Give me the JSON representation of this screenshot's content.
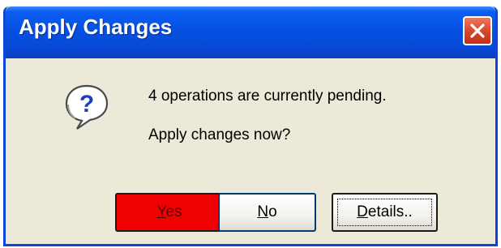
{
  "window": {
    "title": "Apply Changes",
    "close_icon": "close-icon"
  },
  "message": {
    "icon": "question-icon",
    "line1": "4 operations are currently pending.",
    "line2": "Apply changes now?"
  },
  "buttons": {
    "yes": {
      "label": "Yes",
      "mnemonic": "Y",
      "rest": "es"
    },
    "no": {
      "label": "No",
      "mnemonic": "N",
      "rest": "o"
    },
    "details": {
      "label": "Details..",
      "mnemonic": "D",
      "rest": "etails.."
    }
  },
  "colors": {
    "titlebar": "#0751e2",
    "dialog_bg": "#ece9d8",
    "yes_button": "#f00000",
    "close_button": "#d8482a"
  }
}
